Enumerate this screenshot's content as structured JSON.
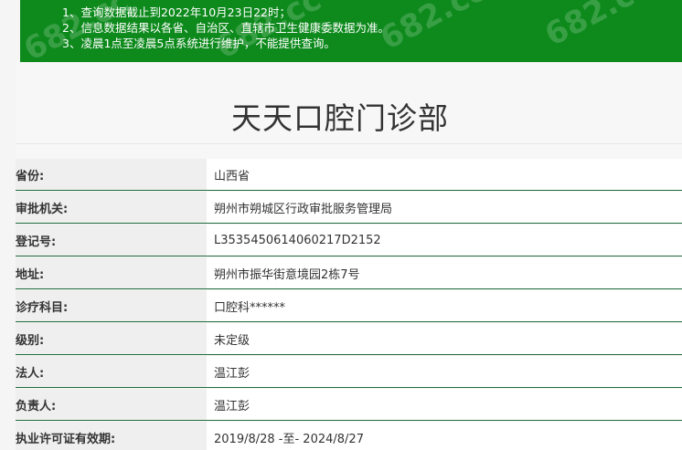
{
  "notice": {
    "lines": [
      "1、查询数据截止到2022年10月23日22时；",
      "2、信息数据结果以各省、自治区、直辖市卫生健康委数据为准。",
      "3、凌晨1点至凌晨5点系统进行维护，不能提供查询。"
    ],
    "watermark": "682.cc",
    "background": "#0e8a1d"
  },
  "title": "天天口腔门诊部",
  "rows": [
    {
      "label": "省份:",
      "value": "山西省"
    },
    {
      "label": "审批机关:",
      "value": "朔州市朔城区行政审批服务管理局"
    },
    {
      "label": "登记号:",
      "value": "L35354506140602​17D2152"
    },
    {
      "label": "地址:",
      "value": "朔州市振华街意境园2栋7号"
    },
    {
      "label": "诊疗科目:",
      "value": "口腔科******"
    },
    {
      "label": "级别:",
      "value": "未定级"
    },
    {
      "label": "法人:",
      "value": "温江彭"
    },
    {
      "label": "负责人:",
      "value": "温江彭"
    },
    {
      "label": "执业许可证有效期:",
      "value": "2019/8/28 -至- 2024/8/27"
    }
  ],
  "colors": {
    "row_border": "#1f6b3a",
    "label_bg": "#efefef",
    "value_bg": "#ffffff"
  }
}
